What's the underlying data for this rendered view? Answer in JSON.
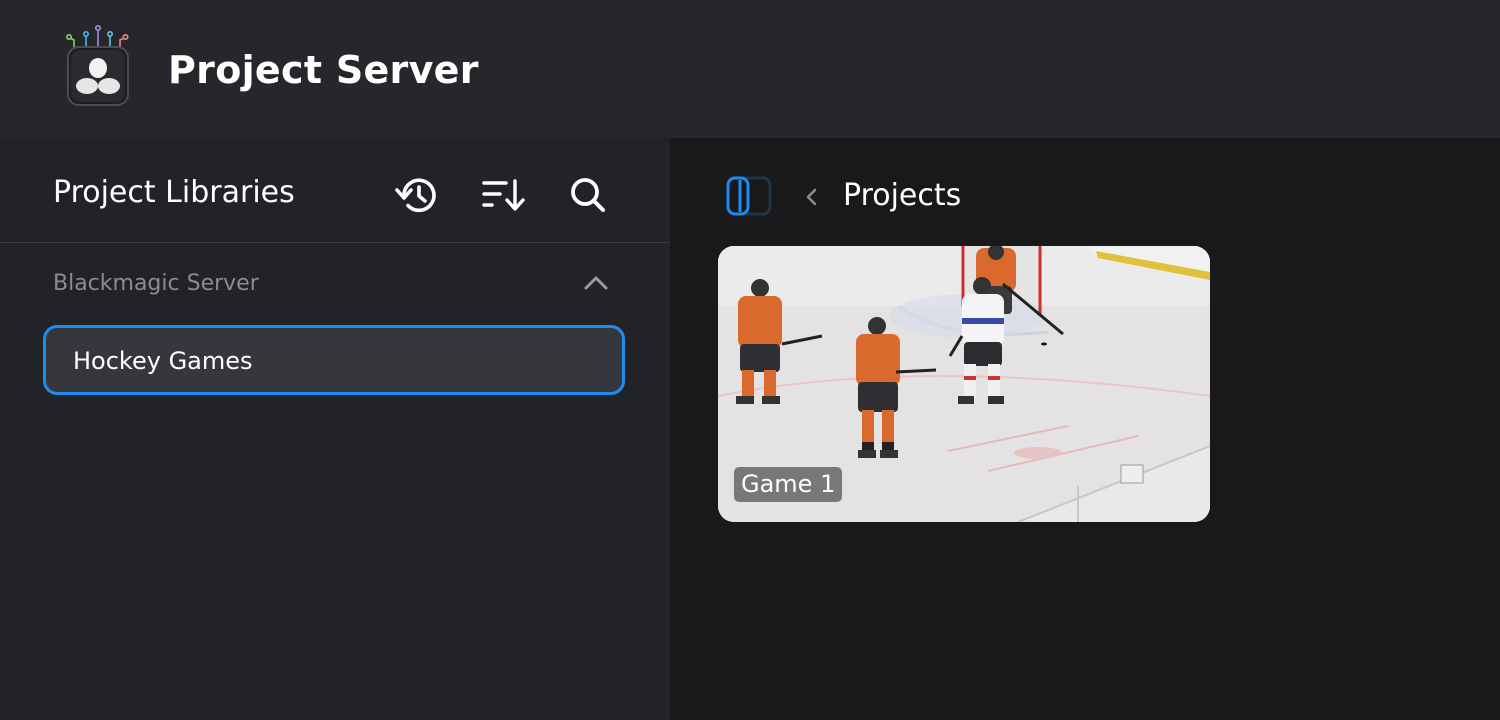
{
  "header": {
    "title": "Project Server",
    "icon": "davinci-resolve-app-icon"
  },
  "sidebar": {
    "title": "Project Libraries",
    "tools": [
      {
        "icon": "history-icon"
      },
      {
        "icon": "sort-icon"
      },
      {
        "icon": "search-icon"
      }
    ],
    "section": {
      "label": "Blackmagic Server",
      "collapse_icon": "chevron-up-icon",
      "items": [
        {
          "label": "Hockey Games",
          "selected": true
        }
      ]
    }
  },
  "main": {
    "breadcrumb": {
      "back_icon": "chevron-left-icon",
      "title": "Projects"
    },
    "projects": [
      {
        "label": "Game 1",
        "thumbnail": "hockey-game-thumbnail"
      }
    ]
  },
  "colors": {
    "accent": "#1e8cf0",
    "header_bg": "#26272b",
    "sidebar_bg": "#222327",
    "main_bg": "#19191b"
  }
}
